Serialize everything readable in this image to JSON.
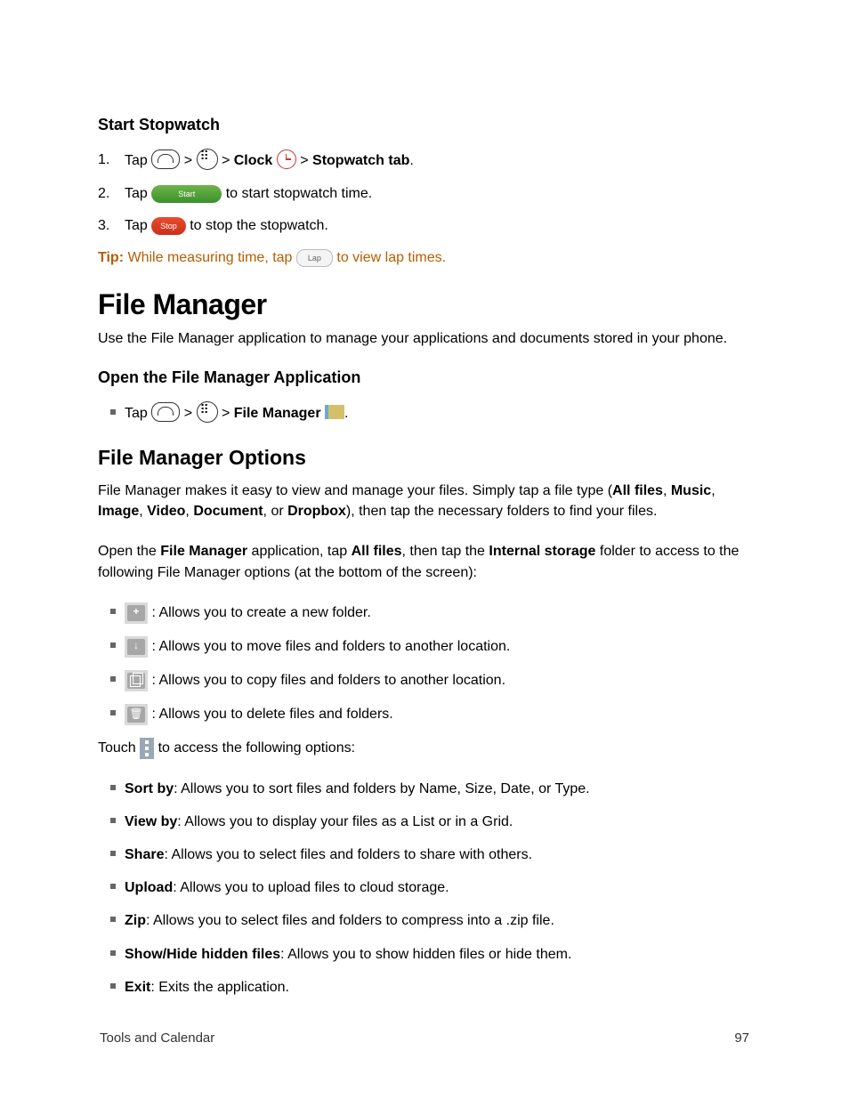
{
  "heading_start": "Start Stopwatch",
  "step1_pre": "Tap",
  "sep": ">",
  "clock_label": "Clock",
  "stopwatch_tab": "Stopwatch tab",
  "step2_pre": "Tap",
  "start_btn": "Start",
  "step2_post": "to start stopwatch time.",
  "step3_pre": "Tap",
  "stop_btn": "Stop",
  "step3_post": "to stop the stopwatch.",
  "tip_label": "Tip:",
  "tip_pre": "While measuring time, tap",
  "lap_btn": "Lap",
  "tip_post": "to view lap times.",
  "h1_fm": "File Manager",
  "fm_intro": "Use the File Manager application to manage your applications and documents stored in your phone.",
  "open_heading": "Open the File Manager Application",
  "open_step_pre": "Tap",
  "fm_label": "File Manager",
  "period": ".",
  "h2_opts": "File Manager Options",
  "opts_p1_a": "File Manager makes it easy to view and manage your files. Simply tap a file type (",
  "allfiles": "All files",
  "music": "Music",
  "image": "Image",
  "video": "Video",
  "document": "Document",
  "or": ", or ",
  "dropbox": "Dropbox",
  "opts_p1_b": "), then tap the necessary folders to find your files.",
  "opts_p2_a": "Open the ",
  "opts_p2_b": " application, tap ",
  "opts_p2_c": ", then tap the ",
  "internal": "Internal storage",
  "opts_p2_d": " folder to access to the following File Manager options (at the bottom of the screen):",
  "icon_items": [
    ": Allows you to create a new folder.",
    ": Allows you to move files and folders to another location.",
    ": Allows you to copy files and folders to another location.",
    ": Allows you to delete files and folders."
  ],
  "touch_text_a": "Touch ",
  "touch_text_b": " to access the following options:",
  "menu_items": [
    {
      "b": "Sort by",
      "t": ": Allows you to sort files and folders by Name, Size, Date, or Type."
    },
    {
      "b": "View by",
      "t": ": Allows you to display your files as a List or in a Grid."
    },
    {
      "b": "Share",
      "t": ": Allows you to select files and folders to share with others."
    },
    {
      "b": "Upload",
      "t": ": Allows you to upload files to cloud storage."
    },
    {
      "b": "Zip",
      "t": ": Allows you to select files and folders to compress into a .zip file."
    },
    {
      "b": "Show/Hide hidden files",
      "t": ": Allows you to show hidden files or hide them."
    },
    {
      "b": "Exit",
      "t": ": Exits the application."
    }
  ],
  "footer_left": "Tools and Calendar",
  "footer_right": "97"
}
